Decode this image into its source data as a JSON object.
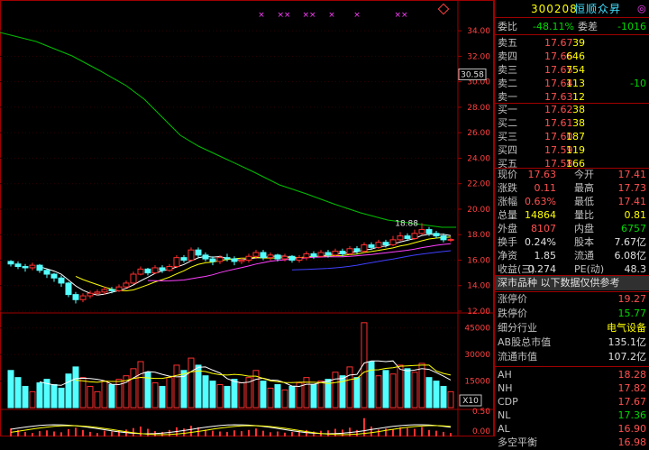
{
  "stock": {
    "code": "300208",
    "name": "恒顺众昇",
    "badge": "◎"
  },
  "order_book_summary": {
    "ratio_label": "委比",
    "ratio_value": "-48.11%",
    "diff_label": "委差",
    "diff_value": "-1016"
  },
  "asks": [
    {
      "label": "卖五",
      "price": "17.67",
      "vol": "39",
      "chg": ""
    },
    {
      "label": "卖四",
      "price": "17.66",
      "vol": "646",
      "chg": ""
    },
    {
      "label": "卖三",
      "price": "17.65",
      "vol": "754",
      "chg": ""
    },
    {
      "label": "卖二",
      "price": "17.64",
      "vol": "113",
      "chg": "-10"
    },
    {
      "label": "卖一",
      "price": "17.63",
      "vol": "12",
      "chg": ""
    }
  ],
  "bids": [
    {
      "label": "买一",
      "price": "17.62",
      "vol": "38"
    },
    {
      "label": "买二",
      "price": "17.61",
      "vol": "38"
    },
    {
      "label": "买三",
      "price": "17.60",
      "vol": "187"
    },
    {
      "label": "买四",
      "price": "17.59",
      "vol": "119"
    },
    {
      "label": "买五",
      "price": "17.58",
      "vol": "166"
    }
  ],
  "quote": [
    {
      "l1": "现价",
      "v1": "17.63",
      "l2": "今开",
      "v2": "17.41"
    },
    {
      "l1": "涨跌",
      "v1": "0.11",
      "l2": "最高",
      "v2": "17.73"
    },
    {
      "l1": "涨幅",
      "v1": "0.63%",
      "l2": "最低",
      "v2": "17.41"
    },
    {
      "l1": "总量",
      "v1": "14864",
      "l2": "量比",
      "v2": "0.81"
    },
    {
      "l1": "外盘",
      "v1": "8107",
      "l2": "内盘",
      "v2": "6757"
    },
    {
      "l1": "换手",
      "v1": "0.24%",
      "l2": "股本",
      "v2": "7.67亿"
    },
    {
      "l1": "净资",
      "v1": "1.85",
      "l2": "流通",
      "v2": "6.08亿"
    },
    {
      "l1": "收益(三)",
      "v1": "0.274",
      "l2": "PE(动)",
      "v2": "48.3"
    }
  ],
  "notice": "深市品种 以下数据仅供参考",
  "extra": [
    {
      "label": "涨停价",
      "value": "19.27"
    },
    {
      "label": "跌停价",
      "value": "15.77"
    },
    {
      "label": "细分行业",
      "value": "电气设备"
    },
    {
      "label": "AB股总市值",
      "value": "135.1亿"
    },
    {
      "label": "流通市值",
      "value": "107.2亿"
    }
  ],
  "indices": [
    {
      "label": "AH",
      "value": "18.28"
    },
    {
      "label": "NH",
      "value": "17.82"
    },
    {
      "label": "CDP",
      "value": "17.67"
    },
    {
      "label": "NL",
      "value": "17.36"
    },
    {
      "label": "AL",
      "value": "16.90"
    },
    {
      "label": "多空平衡",
      "value": "16.98"
    }
  ],
  "chart": {
    "price_axis": [
      "34.00",
      "32.00",
      "30.00",
      "28.00",
      "26.00",
      "24.00",
      "22.00",
      "20.00",
      "18.00",
      "16.00",
      "14.00",
      "12.00"
    ],
    "current_price_tag": "30.58",
    "peak_label": "18.88",
    "volume_axis": [
      "45000",
      "30000",
      "15000"
    ],
    "volume_unit": "X10",
    "indicator_axis": [
      "0.50",
      "0.00"
    ],
    "event_markers": [
      "×",
      "××",
      "××",
      "×",
      "×",
      "××"
    ],
    "colors": {
      "up": "#ff3030",
      "down": "#54ffff",
      "ma_long": "#00c000",
      "ma1": "#ffffff",
      "ma2": "#ffff00",
      "ma3": "#ff40ff",
      "ma4": "#4040ff"
    }
  },
  "chart_data": {
    "type": "candlestick",
    "price_ylim": [
      12,
      35
    ],
    "volume_ylim": [
      0,
      52000
    ],
    "candles": [
      [
        15.9,
        15.7,
        16.0,
        15.5
      ],
      [
        15.7,
        15.5,
        15.9,
        15.3
      ],
      [
        15.5,
        15.4,
        15.7,
        15.1
      ],
      [
        15.4,
        15.6,
        15.8,
        15.2
      ],
      [
        15.6,
        15.2,
        15.7,
        15.0
      ],
      [
        15.2,
        14.9,
        15.3,
        14.6
      ],
      [
        14.9,
        14.6,
        15.0,
        14.3
      ],
      [
        14.6,
        14.2,
        14.8,
        13.9
      ],
      [
        14.2,
        13.3,
        14.3,
        13.1
      ],
      [
        13.3,
        12.9,
        13.5,
        12.6
      ],
      [
        12.9,
        13.2,
        13.4,
        12.7
      ],
      [
        13.2,
        13.4,
        13.6,
        13.0
      ],
      [
        13.4,
        13.5,
        13.7,
        13.2
      ],
      [
        13.5,
        13.7,
        13.9,
        13.3
      ],
      [
        13.7,
        13.6,
        13.9,
        13.4
      ],
      [
        13.6,
        13.9,
        14.1,
        13.5
      ],
      [
        13.9,
        14.2,
        14.4,
        13.8
      ],
      [
        14.2,
        14.9,
        15.1,
        14.1
      ],
      [
        14.9,
        15.3,
        15.5,
        14.8
      ],
      [
        15.3,
        15.0,
        15.4,
        14.8
      ],
      [
        15.0,
        15.4,
        15.6,
        14.9
      ],
      [
        15.4,
        15.2,
        15.6,
        15.0
      ],
      [
        15.2,
        15.5,
        15.7,
        15.1
      ],
      [
        15.5,
        16.2,
        16.4,
        15.4
      ],
      [
        16.2,
        16.0,
        16.4,
        15.8
      ],
      [
        16.0,
        16.8,
        17.0,
        15.9
      ],
      [
        16.8,
        16.4,
        17.0,
        16.2
      ],
      [
        16.4,
        16.1,
        16.6,
        15.9
      ],
      [
        16.1,
        15.9,
        16.3,
        15.6
      ],
      [
        15.9,
        16.2,
        16.4,
        15.7
      ],
      [
        16.2,
        16.1,
        16.5,
        15.9
      ],
      [
        16.1,
        15.9,
        16.3,
        15.6
      ],
      [
        15.9,
        16.0,
        16.2,
        15.7
      ],
      [
        16.0,
        16.3,
        16.5,
        15.8
      ],
      [
        16.3,
        16.6,
        16.8,
        16.1
      ],
      [
        16.6,
        16.2,
        16.8,
        16.0
      ],
      [
        16.2,
        16.4,
        16.6,
        16.0
      ],
      [
        16.4,
        16.1,
        16.5,
        15.9
      ],
      [
        16.1,
        16.3,
        16.5,
        15.9
      ],
      [
        16.3,
        16.0,
        16.4,
        15.8
      ],
      [
        16.0,
        16.2,
        16.4,
        15.8
      ],
      [
        16.2,
        16.5,
        16.7,
        16.0
      ],
      [
        16.5,
        16.3,
        16.7,
        16.1
      ],
      [
        16.3,
        16.6,
        16.8,
        16.2
      ],
      [
        16.6,
        16.4,
        16.8,
        16.2
      ],
      [
        16.4,
        16.7,
        16.9,
        16.3
      ],
      [
        16.7,
        16.5,
        16.9,
        16.3
      ],
      [
        16.5,
        16.9,
        17.1,
        16.4
      ],
      [
        16.9,
        16.7,
        17.1,
        16.5
      ],
      [
        16.7,
        17.2,
        17.4,
        16.6
      ],
      [
        17.2,
        17.0,
        17.4,
        16.8
      ],
      [
        17.0,
        17.4,
        17.6,
        16.9
      ],
      [
        17.4,
        17.2,
        17.6,
        17.0
      ],
      [
        17.2,
        17.6,
        17.9,
        17.1
      ],
      [
        17.6,
        17.9,
        18.2,
        17.5
      ],
      [
        17.9,
        17.7,
        18.1,
        17.5
      ],
      [
        17.7,
        18.1,
        18.4,
        17.6
      ],
      [
        18.1,
        18.4,
        18.9,
        18.0
      ],
      [
        18.4,
        18.1,
        18.6,
        17.9
      ],
      [
        18.1,
        17.9,
        18.3,
        17.7
      ],
      [
        17.9,
        17.6,
        18.1,
        17.4
      ],
      [
        17.6,
        17.63,
        17.73,
        17.41
      ]
    ],
    "volumes": [
      21000,
      17000,
      12000,
      9000,
      14000,
      16000,
      13000,
      11000,
      19000,
      23000,
      17000,
      12000,
      9000,
      15000,
      13000,
      16000,
      18000,
      22000,
      26000,
      20000,
      14000,
      12000,
      17000,
      24000,
      21000,
      28000,
      24000,
      18000,
      15000,
      13000,
      12000,
      16000,
      14000,
      17000,
      21000,
      15000,
      11000,
      13000,
      10000,
      12000,
      14000,
      17000,
      13000,
      15000,
      16000,
      20000,
      18000,
      23000,
      17000,
      48000,
      26000,
      18000,
      21000,
      19000,
      24000,
      22000,
      20000,
      25000,
      17000,
      15000,
      12000,
      9000
    ]
  }
}
